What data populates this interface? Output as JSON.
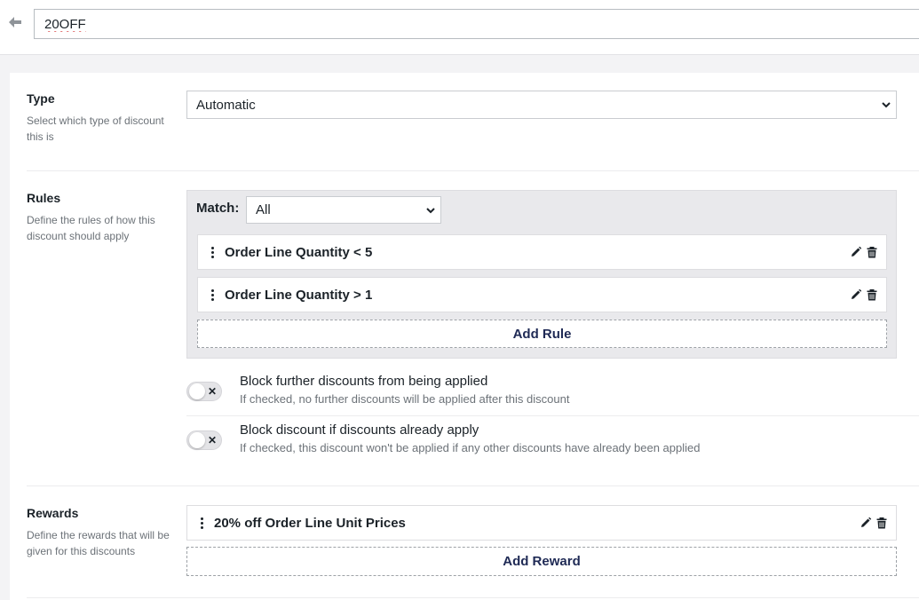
{
  "header": {
    "back_icon": "arrow-left-icon",
    "discount_name": "20OFF"
  },
  "type_section": {
    "title": "Type",
    "description": "Select which type of discount this is",
    "selected": "Automatic"
  },
  "rules_section": {
    "title": "Rules",
    "description": "Define the rules of how this discount should apply",
    "match_label": "Match:",
    "match_selected": "All",
    "rules": [
      {
        "label": "Order Line Quantity < 5"
      },
      {
        "label": "Order Line Quantity > 1"
      }
    ],
    "add_rule_label": "Add Rule",
    "toggles": [
      {
        "title": "Block further discounts from being applied",
        "description": "If checked, no further discounts will be applied after this discount",
        "checked": false
      },
      {
        "title": "Block discount if discounts already apply",
        "description": "If checked, this discount won't be applied if any other discounts have already been applied",
        "checked": false
      }
    ]
  },
  "rewards_section": {
    "title": "Rewards",
    "description": "Define the rewards that will be given for this discounts",
    "rewards": [
      {
        "label": "20% off Order Line Unit Prices"
      }
    ],
    "add_reward_label": "Add Reward"
  },
  "icons": {
    "edit": "pencil-icon",
    "delete": "trash-icon",
    "drag": "drag-handle-icon",
    "toggle_off": "close-icon",
    "select": "chevron-down-icon"
  },
  "colors": {
    "accent_text": "#1f2a55",
    "rules_background": "#e9e9ec",
    "page_background": "#f3f3f5"
  }
}
